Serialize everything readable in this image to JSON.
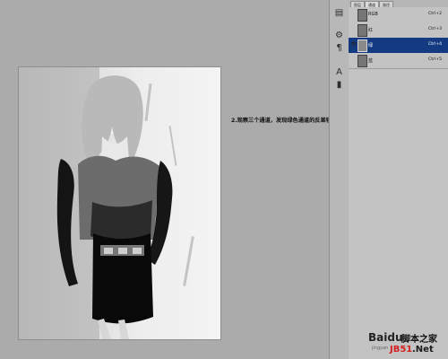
{
  "annotation": "2.观察三个通道，发现绿色通道的反差较为明显",
  "channels": {
    "tabs": [
      "图层",
      "通道",
      "路径"
    ],
    "items": [
      {
        "label": "RGB",
        "shortcut": "Ctrl+2"
      },
      {
        "label": "红",
        "shortcut": "Ctrl+3"
      },
      {
        "label": "绿",
        "shortcut": "Ctrl+4"
      },
      {
        "label": "蓝",
        "shortcut": "Ctrl+5"
      }
    ]
  },
  "watermark": {
    "title": "Baidu",
    "line1": "脚本之家",
    "line2": "JB51",
    "line3": ".Net",
    "small": "jingyan"
  }
}
